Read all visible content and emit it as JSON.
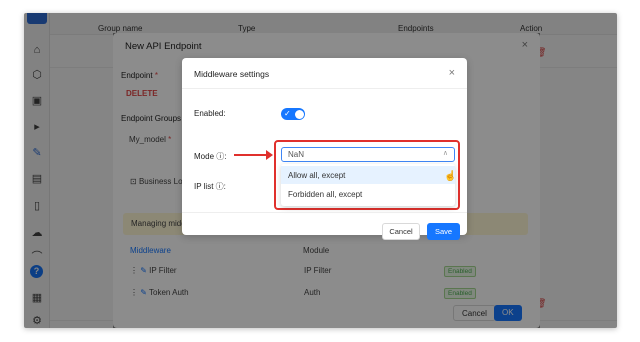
{
  "table_header": {
    "group_name": "Group name",
    "type": "Type",
    "endpoints": "Endpoints",
    "action": "Action"
  },
  "icons": {
    "sidebar": [
      "home-icon",
      "cube-icon",
      "grid-icon",
      "play-icon",
      "plugin-icon",
      "panel-icon",
      "file-icon",
      "cloud-icon",
      "wifi-icon",
      "help-icon",
      "database-icon",
      "settings-icon"
    ],
    "delete": "trash-icon",
    "drag": "drag-handle-icon"
  },
  "colors": {
    "primary": "#1677ff",
    "danger": "#e0302c",
    "success": "#4caf50"
  },
  "endpoint_dialog": {
    "title": "New API Endpoint",
    "close": "×",
    "endpoint_label": "Endpoint",
    "endpoint_method": "DELETE",
    "groups_label": "Endpoint Groups",
    "group_value": "My_model",
    "business_logic": "Business Lo",
    "banner_text": "Managing midd",
    "middleware_header": "Middleware",
    "module_header": "Module",
    "rows": [
      {
        "name": "IP Filter",
        "module": "IP Filter",
        "status": "Enabled"
      },
      {
        "name": "Token Auth",
        "module": "Auth",
        "status": "Enabled"
      }
    ],
    "cancel": "Cancel",
    "ok": "OK"
  },
  "middleware_dialog": {
    "title": "Middleware settings",
    "close": "×",
    "enabled_label": "Enabled",
    "enabled": true,
    "mode_label": "Mode",
    "mode_value": "NaN",
    "ip_list_label": "IP list",
    "options": [
      "Allow all, except",
      "Forbidden all, except"
    ],
    "cancel": "Cancel",
    "save": "Save"
  }
}
